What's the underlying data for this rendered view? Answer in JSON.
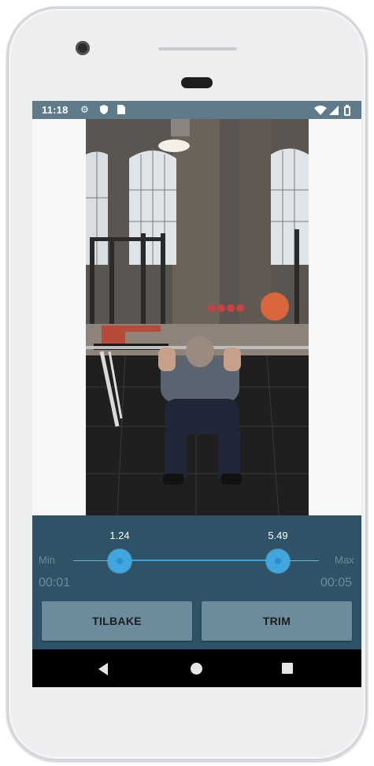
{
  "status_bar": {
    "time": "11:18",
    "left_icons": [
      "settings-icon",
      "shield-icon",
      "sim-card-icon"
    ],
    "right_icons": [
      "wifi-icon",
      "signal-icon",
      "battery-icon"
    ]
  },
  "video": {
    "content": "video-frame-squat"
  },
  "trimmer": {
    "start_value": "1.24",
    "end_value": "5.49",
    "min_label": "Min",
    "max_label": "Max",
    "start_time": "00:01",
    "end_time": "00:05"
  },
  "buttons": {
    "back_label": "TILBAKE",
    "trim_label": "TRIM"
  },
  "nav_bar": {
    "icons": [
      "back-icon",
      "home-icon",
      "recent-apps-icon"
    ]
  },
  "colors": {
    "status_bar": "#5f7a89",
    "panel": "#2e5266",
    "button": "#6c8b9b",
    "slider_accent": "#3fa6de"
  }
}
